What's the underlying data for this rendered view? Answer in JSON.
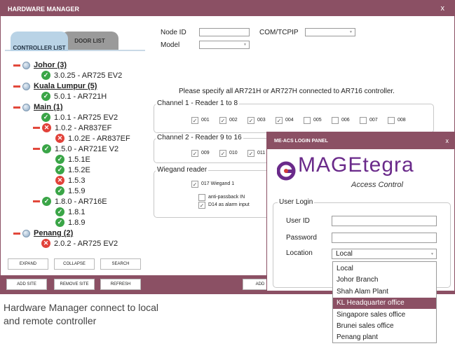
{
  "window": {
    "title": "HARDWARE MANAGER",
    "close": "x"
  },
  "tabs": {
    "controller_list": "CONTROLLER LIST",
    "door_list": "DOOR LIST"
  },
  "tree": [
    {
      "kind": "site",
      "label": "Johor (3)"
    },
    {
      "kind": "ok",
      "label": "3.0.25 - AR725 EV2"
    },
    {
      "kind": "site",
      "label": "Kuala Lumpur (5)"
    },
    {
      "kind": "ok",
      "label": "5.0.1 - AR721H"
    },
    {
      "kind": "site",
      "label": "Main (1)"
    },
    {
      "kind": "ok",
      "label": "1.0.1 - AR725 EV2"
    },
    {
      "kind": "err",
      "label": "1.0.2 - AR837EF"
    },
    {
      "kind": "err",
      "label": "1.0.2E - AR837EF"
    },
    {
      "kind": "ok",
      "label": "1.5.0 - AR721E V2"
    },
    {
      "kind": "ok",
      "label": "1.5.1E"
    },
    {
      "kind": "ok",
      "label": "1.5.2E"
    },
    {
      "kind": "err",
      "label": "1.5.3"
    },
    {
      "kind": "ok",
      "label": "1.5.9"
    },
    {
      "kind": "ok",
      "label": "1.8.0 - AR716E"
    },
    {
      "kind": "ok",
      "label": "1.8.1"
    },
    {
      "kind": "ok",
      "label": "1.8.9"
    },
    {
      "kind": "site",
      "label": "Penang (2)"
    },
    {
      "kind": "err",
      "label": "2.0.2 - AR725 EV2"
    }
  ],
  "tree_buttons": {
    "expand": "EXPAND",
    "collapse": "COLLAPSE",
    "search": "SEARCH"
  },
  "bottom_buttons": {
    "add_site": "ADD SITE",
    "remove_site": "REMOVE SITE",
    "refresh": "REFRESH",
    "add": "ADD"
  },
  "form": {
    "node_id_label": "Node ID",
    "node_id_value": "",
    "com_label": "COM/TCPIP",
    "model_label": "Model",
    "instruction": "Please specify all AR721H or AR727H connected to AR716 controller."
  },
  "channel1": {
    "title": "Channel 1 - Reader 1 to 8",
    "items": [
      {
        "label": "001",
        "checked": true
      },
      {
        "label": "002",
        "checked": true
      },
      {
        "label": "003",
        "checked": true
      },
      {
        "label": "004",
        "checked": true
      },
      {
        "label": "005",
        "checked": false
      },
      {
        "label": "006",
        "checked": false
      },
      {
        "label": "007",
        "checked": false
      },
      {
        "label": "008",
        "checked": false
      }
    ]
  },
  "channel2": {
    "title": "Channel 2 - Reader 9 to 16",
    "items": [
      {
        "label": "009",
        "checked": true
      },
      {
        "label": "010",
        "checked": true
      },
      {
        "label": "011",
        "checked": true
      }
    ]
  },
  "wiegand": {
    "title": "Wiegand reader",
    "w017": "017 Wiegand 1",
    "antipassback": "anti-passback IN",
    "d14": "D14 as alarm input"
  },
  "login": {
    "title": "ME-ACS LOGIN PANEL",
    "close": "x",
    "logo_text": "MAGEtegra",
    "logo_sub": "Access Control",
    "group_title": "User Login",
    "user_id_label": "User ID",
    "password_label": "Password",
    "location_label": "Location",
    "location_value": "Local"
  },
  "location_options": [
    "Local",
    "Johor Branch",
    "Shah Alam Plant",
    "KL Headquarter office",
    "Singapore sales office",
    "Brunei sales office",
    "Penang plant"
  ],
  "location_selected": "KL Headquarter office",
  "caption": {
    "line1": "Hardware Manager connect to local",
    "line2": "and remote controller"
  },
  "colors": {
    "accent": "#8b5064",
    "ok": "#3aa547",
    "error": "#e1423a",
    "tab": "#b9d3e6"
  }
}
